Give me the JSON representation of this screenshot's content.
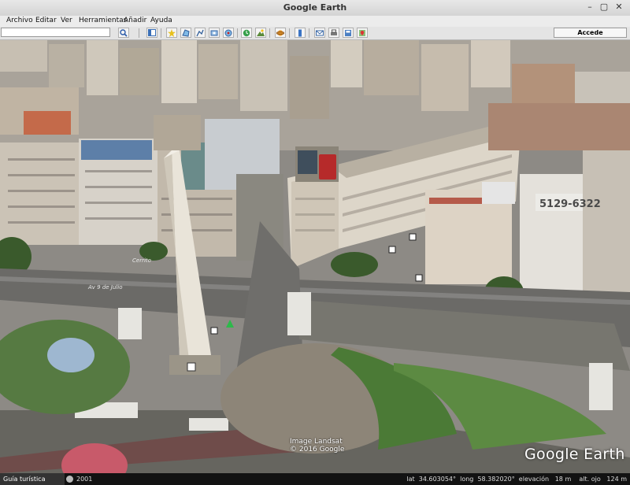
{
  "window": {
    "title": "Google Earth",
    "controls": {
      "minimize": "–",
      "maximize": "▢",
      "close": "✕"
    }
  },
  "menu": [
    {
      "label": "Archivo"
    },
    {
      "label": "Editar"
    },
    {
      "label": "Ver"
    },
    {
      "label": "Herramientas"
    },
    {
      "label": "Añadir"
    },
    {
      "label": "Ayuda"
    }
  ],
  "toolbar": {
    "search_value": "",
    "login_label": "Accede",
    "icons": [
      "search-icon",
      "sidebar-icon",
      "placemark-icon",
      "polygon-icon",
      "path-icon",
      "overlay-icon",
      "record-tour-icon",
      "historical-imagery-icon",
      "sun-icon",
      "planets-icon",
      "ruler-icon",
      "email-icon",
      "print-icon",
      "save-image-icon",
      "google-maps-icon"
    ]
  },
  "map": {
    "labels": {
      "avenue": "Cerrito",
      "avenue2": "Av 9 de Julio",
      "billboard": "5129-6322"
    },
    "attribution": {
      "line1": "Image Landsat",
      "line2": "© 2016 Google"
    },
    "logo": "Google Earth"
  },
  "status": {
    "tour_label": "Guía turística",
    "year": "2001",
    "coords": "lat  34.603054°  long  58.382020°  elevación   18 m    alt. ojo   124 m"
  },
  "colors": {
    "sky": "#9aa7b0",
    "road": "#6d6d6b",
    "grass": "#3e6a32",
    "building": "#d4ccc0",
    "obelisk": "#e8e3d8"
  }
}
